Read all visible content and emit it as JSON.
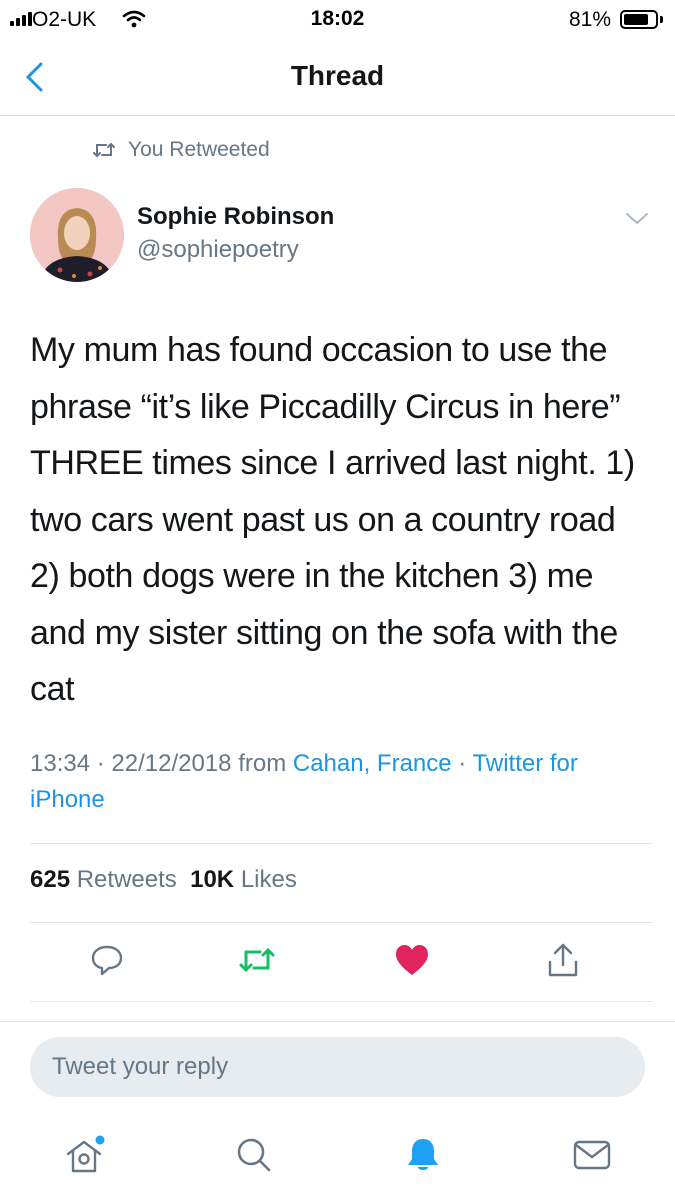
{
  "status_bar": {
    "carrier": "O2-UK",
    "time": "18:02",
    "battery_percent_text": "81%",
    "battery_level": 0.81
  },
  "nav": {
    "title": "Thread"
  },
  "tweet": {
    "retweet_context": "You Retweeted",
    "author_name": "Sophie Robinson",
    "author_handle": "@sophiepoetry",
    "text": "My mum has found occasion to use the phrase “it’s like Piccadilly Circus in here” THREE times since I arrived last night. 1) two cars went past us on a country road 2) both dogs were in the kitchen 3) me and my sister sitting on the sofa with the cat",
    "timestamp": "13:34 · 22/12/2018",
    "from_label": "from",
    "location": "Cahan, France",
    "separator": "·",
    "source": "Twitter for iPhone",
    "retweets_count": "625",
    "retweets_label": "Retweets",
    "likes_count": "10K",
    "likes_label": "Likes"
  },
  "actions": {
    "reply_icon": "reply-icon",
    "retweet_icon": "retweet-icon",
    "like_icon": "heart-icon",
    "share_icon": "share-icon"
  },
  "reply": {
    "placeholder": "Tweet your reply"
  },
  "colors": {
    "accent": "#1b95e0",
    "retweet_green": "#17bf63",
    "like_red": "#e0245e",
    "muted": "#657786",
    "text": "#14171a"
  }
}
